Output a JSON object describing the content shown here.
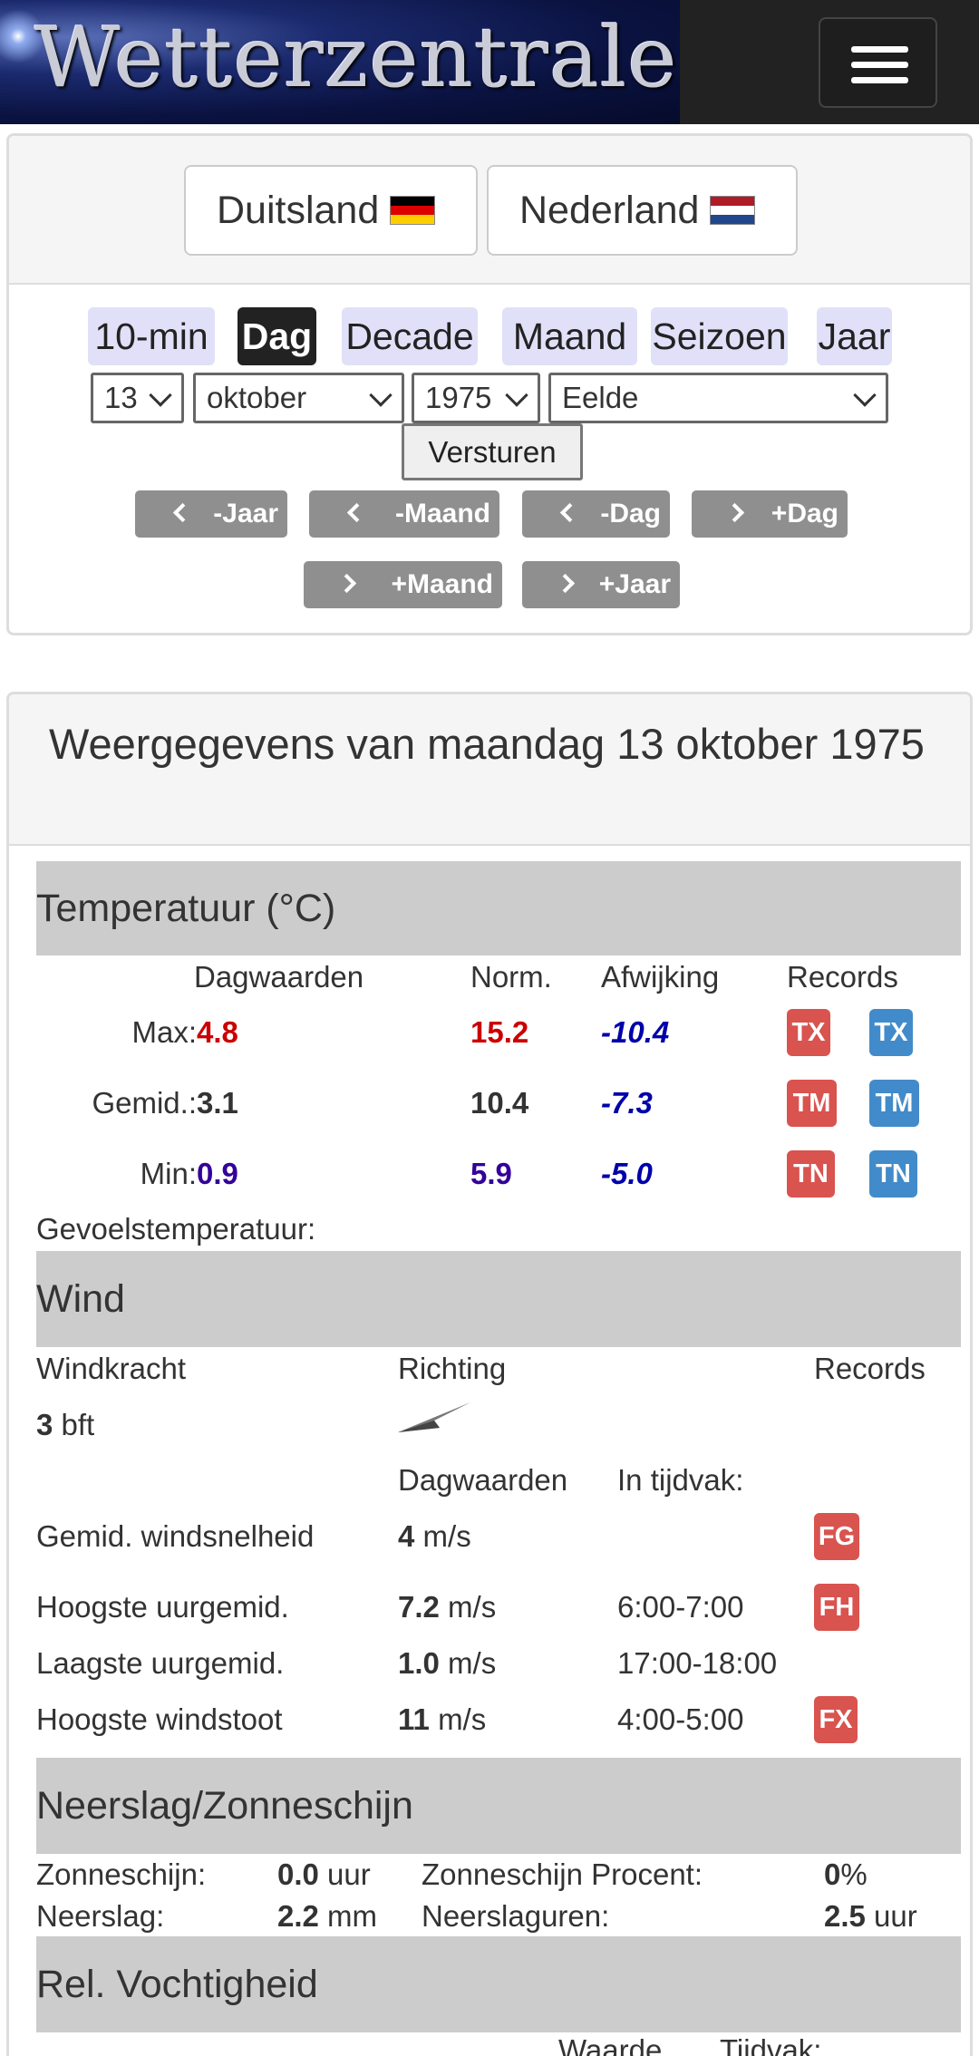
{
  "header": {
    "logo_text": "Wetterzentrale",
    "menu_icon": "hamburger-icon"
  },
  "countries": [
    {
      "label": "Duitsland",
      "flag": "flag-de"
    },
    {
      "label": "Nederland",
      "flag": "flag-nl"
    }
  ],
  "period_tabs": [
    "10-min",
    "Dag",
    "Decade",
    "Maand",
    "Seizoen",
    "Jaar"
  ],
  "active_tab": "Dag",
  "form": {
    "day": "13",
    "month": "oktober",
    "year": "1975",
    "station": "Eelde",
    "submit": "Versturen"
  },
  "nav": [
    "-Jaar",
    "-Maand",
    "-Dag",
    "+Dag",
    "+Maand",
    "+Jaar"
  ],
  "report": {
    "title": "Weergegevens van maandag 13 oktober 1975",
    "temperature": {
      "heading": "Temperatuur (°C)",
      "cols": {
        "day": "Dagwaarden",
        "norm": "Norm.",
        "dev": "Afwijking",
        "records": "Records"
      },
      "rows": [
        {
          "label": "Max:",
          "value": "4.8",
          "norm": "15.2",
          "dev": "-10.4",
          "rec1": "TX",
          "rec2": "TX"
        },
        {
          "label": "Gemid.:",
          "value": "3.1",
          "norm": "10.4",
          "dev": "-7.3",
          "rec1": "TM",
          "rec2": "TM"
        },
        {
          "label": "Min:",
          "value": "0.9",
          "norm": "5.9",
          "dev": "-5.0",
          "rec1": "TN",
          "rec2": "TN"
        }
      ],
      "feels_like": "Gevoelstemperatuur:"
    },
    "wind": {
      "heading": "Wind",
      "cols": {
        "force": "Windkracht",
        "direction": "Richting",
        "records": "Records",
        "day": "Dagwaarden",
        "period": "In tijdvak:"
      },
      "force_value": "3",
      "force_unit": "bft",
      "direction_icon": "wind-arrow-icon",
      "rows": [
        {
          "label": "Gemid. windsnelheid",
          "value": "4",
          "unit": "m/s",
          "period": "",
          "rec": "FG"
        },
        {
          "label": "Hoogste uurgemid.",
          "value": "7.2",
          "unit": "m/s",
          "period": "6:00-7:00",
          "rec": "FH"
        },
        {
          "label": "Laagste uurgemid.",
          "value": "1.0",
          "unit": "m/s",
          "period": "17:00-18:00",
          "rec": ""
        },
        {
          "label": "Hoogste windstoot",
          "value": "11",
          "unit": "m/s",
          "period": "4:00-5:00",
          "rec": "FX"
        }
      ]
    },
    "precip": {
      "heading": "Neerslag/Zonneschijn",
      "sun_label": "Zonneschijn:",
      "sun_value": "0.0",
      "sun_unit": "uur",
      "sunpct_label": "Zonneschijn Procent:",
      "sunpct_value": "0",
      "sunpct_unit": "%",
      "rain_label": "Neerslag:",
      "rain_value": "2.2",
      "rain_unit": "mm",
      "rainhrs_label": "Neerslaguren:",
      "rainhrs_value": "2.5",
      "rainhrs_unit": "uur"
    },
    "humidity": {
      "heading": "Rel. Vochtigheid",
      "col_value": "Waarde",
      "col_period": "Tijdvak:"
    }
  }
}
